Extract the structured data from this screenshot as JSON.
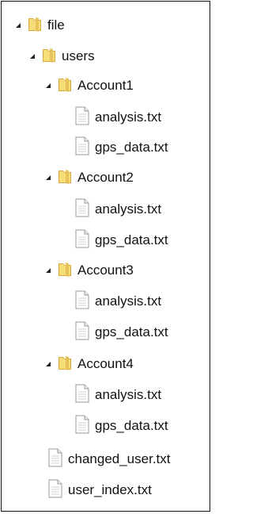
{
  "tree": {
    "root": {
      "label": "file"
    },
    "users": {
      "label": "users"
    },
    "accounts": [
      {
        "label": "Account1",
        "files": [
          "analysis.txt",
          "gps_data.txt"
        ]
      },
      {
        "label": "Account2",
        "files": [
          "analysis.txt",
          "gps_data.txt"
        ]
      },
      {
        "label": "Account3",
        "files": [
          "analysis.txt",
          "gps_data.txt"
        ]
      },
      {
        "label": "Account4",
        "files": [
          "analysis.txt",
          "gps_data.txt"
        ]
      }
    ],
    "root_files": [
      "changed_user.txt",
      "user_index.txt"
    ]
  },
  "icons": {
    "expand": "expanded-triangle-icon",
    "folder": "folder-icon",
    "file": "text-file-icon"
  },
  "colors": {
    "folder_light": "#f7dc7a",
    "folder_dark": "#d8a93a",
    "file_border": "#9a9a9a",
    "file_lines": "#d0d0d0"
  }
}
